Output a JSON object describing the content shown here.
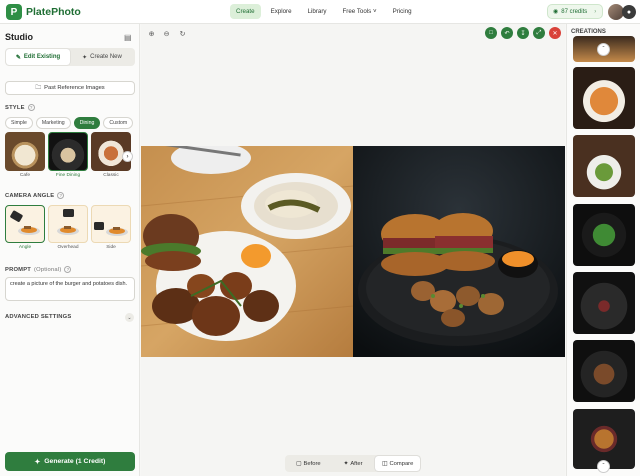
{
  "app": {
    "name": "PlatePhoto",
    "logo_glyph": "P"
  },
  "nav": {
    "items": [
      {
        "label": "Create",
        "active": true
      },
      {
        "label": "Explore",
        "active": false
      },
      {
        "label": "Library",
        "active": false
      },
      {
        "label": "Free Tools ˅",
        "active": false
      },
      {
        "label": "Pricing",
        "active": false
      }
    ],
    "credits_label": "87 credits",
    "credits_icon": "coins-icon",
    "notification_count": "●"
  },
  "studio": {
    "title": "Studio",
    "collapse_icon": "▤",
    "modes": {
      "edit": "Edit Existing",
      "create": "Create New",
      "active": "edit"
    },
    "past_reference_label": "Past Reference Images",
    "style": {
      "label": "STYLE",
      "tabs": [
        "Simple",
        "Marketing",
        "Dining",
        "Custom"
      ],
      "active_tab": "Dining",
      "options": [
        {
          "label": "Cafe",
          "active": false
        },
        {
          "label": "Fine Dining",
          "active": true
        },
        {
          "label": "Classic",
          "active": false
        }
      ]
    },
    "camera_angle": {
      "label": "CAMERA ANGLE",
      "options": [
        {
          "label": "Angle",
          "active": true
        },
        {
          "label": "Overhead",
          "active": false
        },
        {
          "label": "Side",
          "active": false
        }
      ]
    },
    "prompt": {
      "label": "PROMPT",
      "optional": "(Optional)",
      "value": "create a picture of the burger and potatoes dish."
    },
    "advanced_settings_label": "ADVANCED SETTINGS",
    "generate_label": "Generate (1 Credit)"
  },
  "canvas": {
    "tools": [
      "zoom-in-icon",
      "zoom-out-icon",
      "reset-icon"
    ],
    "actions": [
      {
        "name": "comment-icon",
        "color": "#2f7d3e"
      },
      {
        "name": "undo-icon",
        "color": "#2f7d3e"
      },
      {
        "name": "download-icon",
        "color": "#2f7d3e"
      },
      {
        "name": "expand-icon",
        "color": "#2f7d3e"
      },
      {
        "name": "close-icon",
        "color": "#d9423a"
      }
    ],
    "view_modes": [
      {
        "label": "Before",
        "active": false
      },
      {
        "label": "After",
        "active": false
      },
      {
        "label": "Compare",
        "active": true
      }
    ]
  },
  "creations": {
    "title": "CREATIONS"
  }
}
